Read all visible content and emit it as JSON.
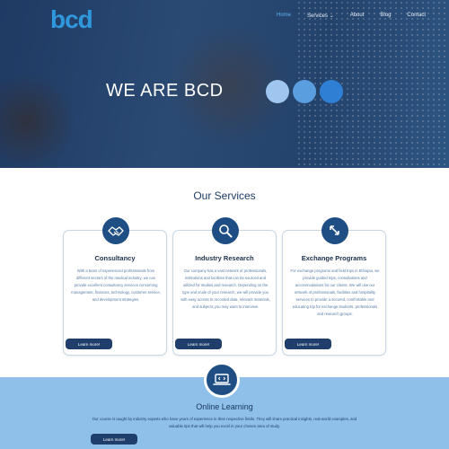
{
  "brand": {
    "logo_text": "bcd",
    "accent": "#2f98dd",
    "primary": "#1f4e85"
  },
  "nav": {
    "items": [
      "Home",
      "Services ⌄",
      "About",
      "Blog",
      "Contact"
    ],
    "active": "Home"
  },
  "hero": {
    "title": "WE ARE  BCD"
  },
  "services": {
    "title": "Our Services",
    "cards": [
      {
        "icon": "handshake-icon",
        "title": "Consultancy",
        "text": "With a team of experienced professionals from different sectors of the medical industry, we can provide excellent consultancy services concerning management, finances, technology, customer service, and development strategies.",
        "button": "Learn more!"
      },
      {
        "icon": "magnifier-icon",
        "title": "Industry Research",
        "text": "Our company has a vast network of professionals, institutions and facilities that can be sourced and utilized for studies and research. Depending on the type and scale of your research, we will provide you with easy access to recorded data, relevant materials, and subjects you may want to interview.",
        "button": "Learn more!"
      },
      {
        "icon": "exchange-arrows-icon",
        "title": "Exchange Programs",
        "text": "For exchange programs and field trips in Ethiopia, we provide guided trips, consultations and accommodations for our clients. We will use our network of professionals, facilities and hospitality services to provide a secured, comfortable and educating trip for exchange students, professionals and research groups.",
        "button": "Learn more!"
      }
    ]
  },
  "online_learning": {
    "icon": "laptop-code-icon",
    "title": "Online Learning",
    "text": "Our course is taught by industry experts who have years of experience in their respective fields. They will share practical insights, real-world examples, and valuable tips that will help you excel in your chosen area of study.",
    "button": "Learn more!"
  }
}
